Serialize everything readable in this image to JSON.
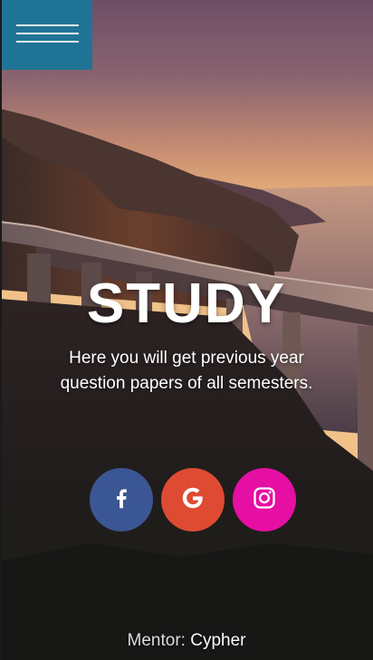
{
  "menu": {
    "icon": "hamburger-icon",
    "color": "#1f7496"
  },
  "hero": {
    "title": "STUDY",
    "subtitle_line1": "Here you will get previous year",
    "subtitle_line2": "question papers of all semesters."
  },
  "social": [
    {
      "network": "facebook",
      "icon": "facebook-icon",
      "color": "#3b5694"
    },
    {
      "network": "google",
      "icon": "google-icon",
      "color": "#df4a32"
    },
    {
      "network": "instagram",
      "icon": "instagram-icon",
      "color": "#e60fa3"
    }
  ],
  "footer": {
    "label": "Mentor:",
    "name": "Cypher"
  }
}
